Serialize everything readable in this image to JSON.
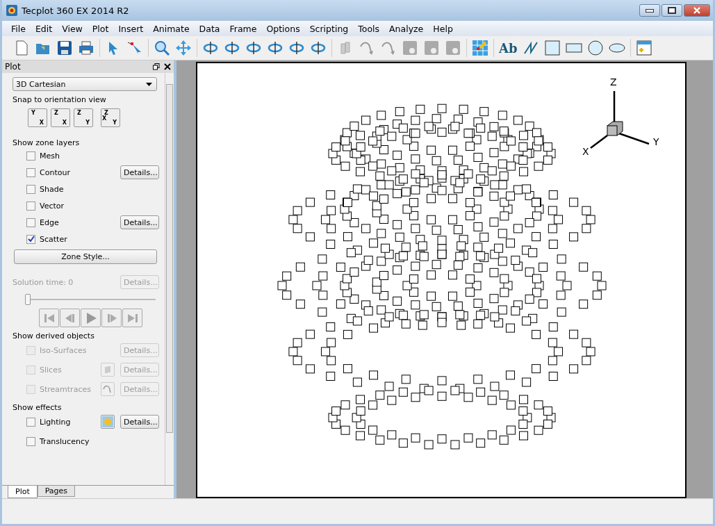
{
  "window": {
    "title": "Tecplot 360 EX 2014 R2"
  },
  "menu": [
    "File",
    "Edit",
    "View",
    "Plot",
    "Insert",
    "Animate",
    "Data",
    "Frame",
    "Options",
    "Scripting",
    "Tools",
    "Analyze",
    "Help"
  ],
  "toolbar": {
    "text_tool": "Ab"
  },
  "panel": {
    "title": "Plot",
    "plot_type": "3D Cartesian",
    "snap_label": "Snap to orientation view",
    "orientation_buttons": [
      {
        "top": "Y",
        "bottom": "X"
      },
      {
        "top": "Z",
        "bottom": "X"
      },
      {
        "top": "Z",
        "bottom": "Y"
      },
      {
        "top": "Z",
        "left": "X",
        "bottom": "Y"
      }
    ],
    "zone_layers_label": "Show zone layers",
    "zone_layers": [
      {
        "label": "Mesh",
        "checked": false
      },
      {
        "label": "Contour",
        "checked": false,
        "details": "Details..."
      },
      {
        "label": "Shade",
        "checked": false
      },
      {
        "label": "Vector",
        "checked": false
      },
      {
        "label": "Edge",
        "checked": false,
        "details": "Details..."
      },
      {
        "label": "Scatter",
        "checked": true
      }
    ],
    "zone_style": "Zone Style...",
    "solution_time": {
      "label": "Solution time: 0",
      "details": "Details...",
      "disabled": true,
      "level": 0
    },
    "derived_label": "Show derived objects",
    "derived": [
      {
        "label": "Iso-Surfaces",
        "checked": false,
        "disabled": true,
        "details": "Details..."
      },
      {
        "label": "Slices",
        "checked": false,
        "disabled": true,
        "details": "Details...",
        "kind": "slice"
      },
      {
        "label": "Streamtraces",
        "checked": false,
        "disabled": true,
        "details": "Details...",
        "kind": "stream"
      }
    ],
    "effects_label": "Show effects",
    "effects": [
      {
        "label": "Lighting",
        "checked": false,
        "disabled": false,
        "details": "Details...",
        "kind": "light"
      },
      {
        "label": "Translucency",
        "checked": false,
        "disabled": false
      }
    ]
  },
  "tabs": [
    {
      "label": "Plot",
      "selected": true
    },
    {
      "label": "Pages",
      "selected": false
    }
  ],
  "axes": {
    "z": "Z",
    "y": "Y",
    "x": "X"
  }
}
